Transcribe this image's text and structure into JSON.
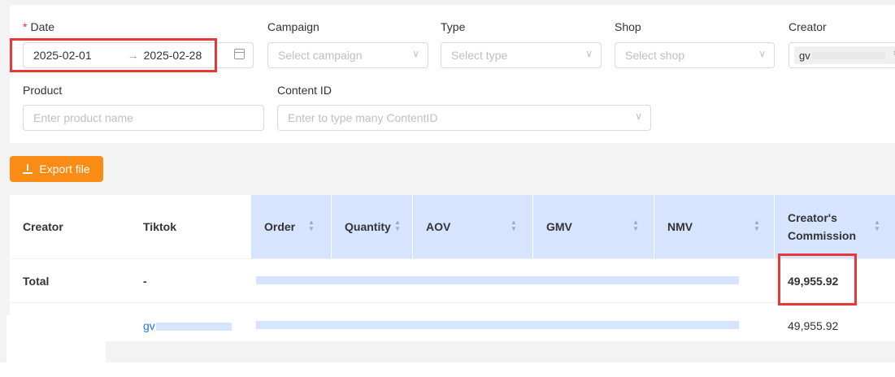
{
  "filters": {
    "date": {
      "label": "Date",
      "start": "2025-02-01",
      "arrow": "→",
      "end": "2025-02-28"
    },
    "campaign": {
      "label": "Campaign",
      "placeholder": "Select campaign"
    },
    "type": {
      "label": "Type",
      "placeholder": "Select type"
    },
    "shop": {
      "label": "Shop",
      "placeholder": "Select shop"
    },
    "creator": {
      "label": "Creator",
      "value": "gv",
      "remove": "×"
    },
    "product": {
      "label": "Product",
      "placeholder": "Enter product name"
    },
    "content_id": {
      "label": "Content ID",
      "placeholder": "Enter to type many ContentID"
    }
  },
  "export_button": {
    "label": "Export file"
  },
  "table": {
    "columns": [
      "Creator",
      "Tiktok",
      "Order",
      "Quantity",
      "AOV",
      "GMV",
      "NMV",
      "Creator's",
      "Commission"
    ],
    "total_row": {
      "creator": "Total",
      "tiktok": "-",
      "commission": "49,955.92"
    },
    "data_row": {
      "tiktok": "gv",
      "commission": "49,955.92"
    }
  },
  "colors": {
    "accent": "#fa8c16",
    "highlight": "#e53935",
    "header_blue": "#d6e4ff",
    "link": "#1677ff"
  }
}
